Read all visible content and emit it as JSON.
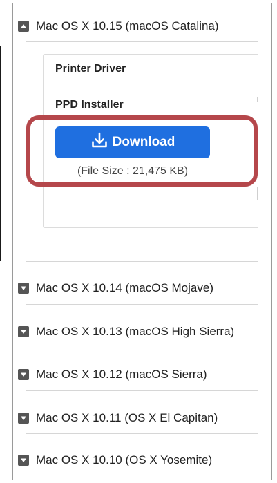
{
  "accordion": {
    "expanded": {
      "label": "Mac OS X 10.15 (macOS Catalina)",
      "icon": "collapse-icon",
      "sections": {
        "printer_driver": "Printer Driver",
        "ppd_installer": "PPD Installer"
      },
      "download": {
        "label": "Download",
        "icon": "download-icon",
        "file_size": "(File Size : 21,475 KB)"
      }
    },
    "items": [
      {
        "label": "Mac OS X 10.14 (macOS Mojave)",
        "icon": "expand-icon"
      },
      {
        "label": "Mac OS X 10.13 (macOS High Sierra)",
        "icon": "expand-icon"
      },
      {
        "label": "Mac OS X 10.12 (macOS Sierra)",
        "icon": "expand-icon"
      },
      {
        "label": "Mac OS X 10.11 (OS X El Capitan)",
        "icon": "expand-icon"
      },
      {
        "label": "Mac OS X 10.10 (OS X Yosemite)",
        "icon": "expand-icon"
      }
    ]
  },
  "colors": {
    "button": "#1f6fe0",
    "highlight": "#b5474b",
    "toggle": "#555555"
  }
}
